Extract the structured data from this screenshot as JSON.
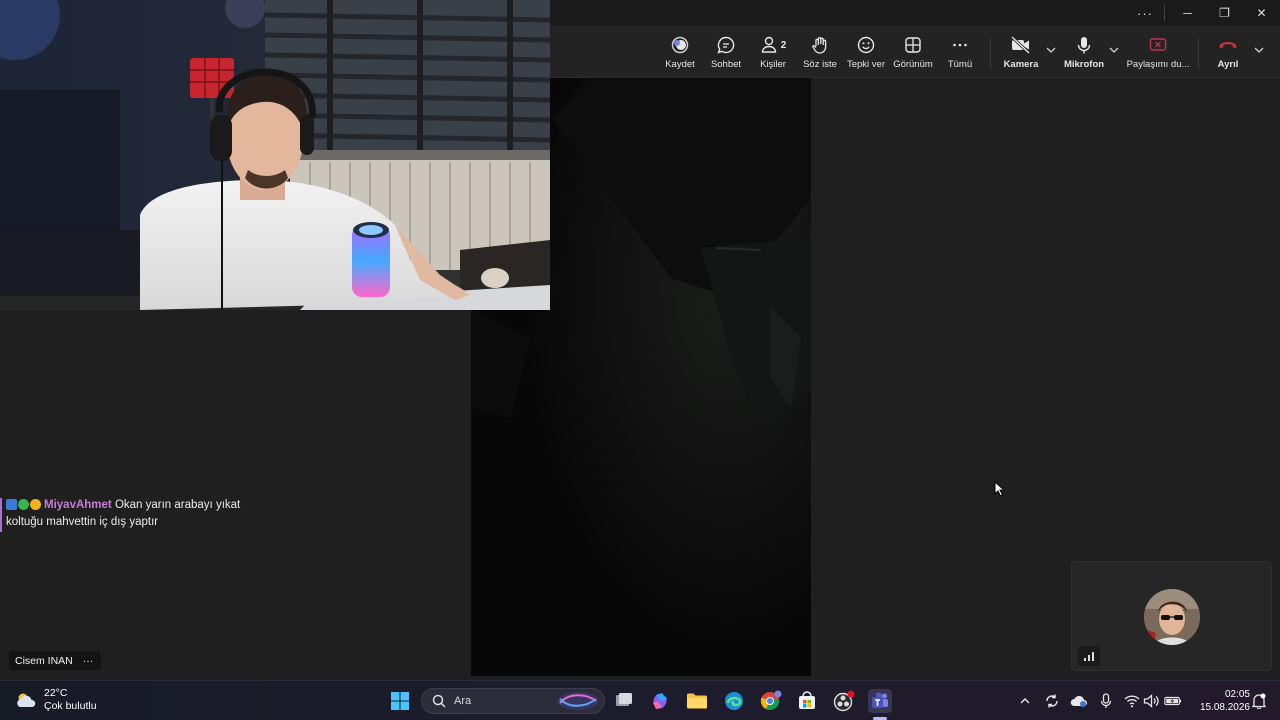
{
  "window": {
    "more_label": "···",
    "minimize_label": "─",
    "restore_label": "❐",
    "close_label": "✕"
  },
  "toolbar": {
    "record_label": "Kaydet",
    "chat_label": "Sohbet",
    "people_label": "Kişiler",
    "people_count": "2",
    "raise_hand_label": "Söz iste",
    "react_label": "Tepki ver",
    "view_label": "Görünüm",
    "more_label": "Tümü",
    "camera_label": "Kamera",
    "mic_label": "Mikrofon",
    "share_label": "Paylaşımı du...",
    "leave_label": "Ayrıl"
  },
  "chat": {
    "username": "MiyavAhmet",
    "message": "Okan yarın arabayı yıkat koltuğu mahvettin iç dış yaptır",
    "username_color": "#c77dd8"
  },
  "participant": {
    "name": "Cisem INAN",
    "more_label": "···"
  },
  "taskbar": {
    "weather_temp": "22°C",
    "weather_desc": "Çok bulutlu",
    "search_placeholder": "Ara",
    "time": "02:05",
    "date": "15.08.2026"
  },
  "colors": {
    "accent_purple": "#7b83eb",
    "leave_red": "#d13438",
    "share_red": "#c4314b"
  }
}
